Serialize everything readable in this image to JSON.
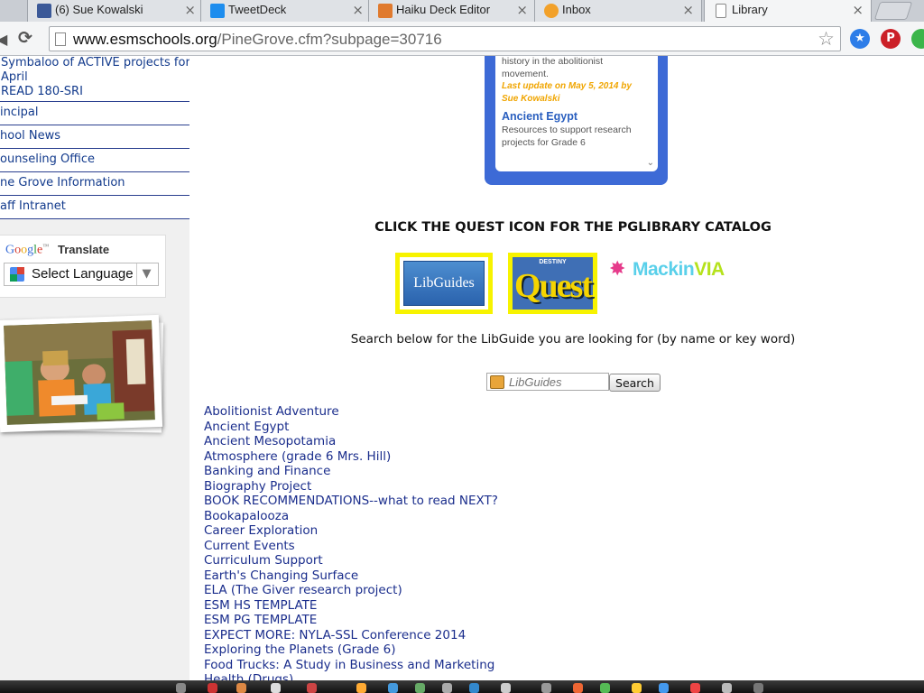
{
  "tabs": [
    {
      "label": "(6) Sue Kowalski",
      "icon": "facebook-icon",
      "color": "#3b5998"
    },
    {
      "label": "TweetDeck",
      "icon": "tweetdeck-icon",
      "color": "#1d8dee"
    },
    {
      "label": "Haiku Deck Editor",
      "icon": "haiku-deck-icon",
      "color": "#e07a2e"
    },
    {
      "label": "Inbox",
      "icon": "inbox-icon",
      "color": "#f2a12a"
    },
    {
      "label": "Library",
      "icon": "page-icon",
      "color": "#ffffff"
    }
  ],
  "tab_close_glyph": "×",
  "toolbar": {
    "url_host": "www.esmschools.org",
    "url_path": "/PineGrove.cfm?subpage=30716"
  },
  "sidebar": {
    "nav_multi": [
      "Symbaloo of ACTIVE projects for",
      "April",
      "READ 180-SRI"
    ],
    "nav_items": [
      "incipal",
      "hool News",
      "ounseling Office",
      "ne Grove Information",
      "aff Intranet"
    ]
  },
  "translate": {
    "brand": "Google",
    "trademark": "™",
    "label": "Translate",
    "select_value": "Select Language"
  },
  "rss": {
    "desc_1": "history in the abolitionist movement.",
    "date": "Last update on May 5, 2014 by Sue Kowalski",
    "title_2": "Ancient Egypt",
    "desc_2": "Resources to support research projects for Grade 6"
  },
  "catalog": {
    "heading": "CLICK THE QUEST ICON FOR THE PGLIBRARY CATALOG",
    "libguides_label": "LibGuides",
    "quest_small": "DESTINY",
    "quest_big": "Quest",
    "mackin_main": "Mackin",
    "mackin_via": "VIA"
  },
  "search": {
    "intro": "Search below for the LibGuide you are looking for (by name or key word)",
    "placeholder": "LibGuides",
    "button": "Search"
  },
  "guides": [
    "Abolitionist Adventure",
    "Ancient Egypt",
    "Ancient Mesopotamia",
    "Atmosphere (grade 6 Mrs. Hill)",
    "Banking and Finance",
    "Biography Project",
    "BOOK RECOMMENDATIONS--what to read NEXT?",
    "Bookapalooza",
    "Career Exploration",
    "Current Events",
    "Curriculum Support",
    "Earth's Changing Surface",
    "ELA (The Giver research project)",
    "ESM HS TEMPLATE",
    "ESM PG TEMPLATE",
    "EXPECT MORE: NYLA-SSL Conference 2014",
    "Exploring the Planets (Grade 6)",
    "Food Trucks: A Study in Business and Marketing",
    "Health (Drugs)"
  ]
}
